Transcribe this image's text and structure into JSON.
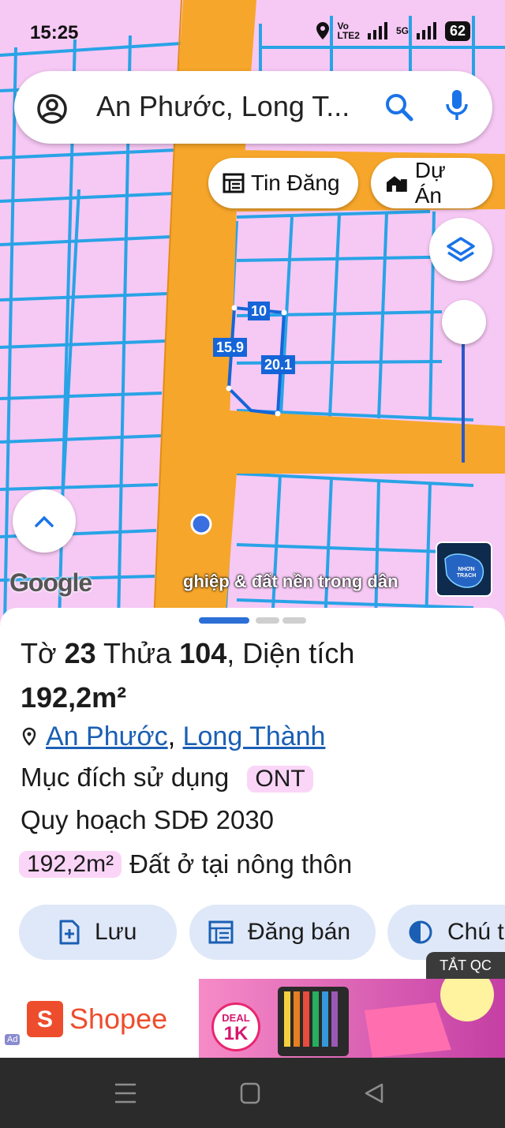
{
  "status_bar": {
    "time": "15:25",
    "net1": "Vo\nLTE2",
    "net2": "5G",
    "battery": "62"
  },
  "search": {
    "text": "An Phước, Long T..."
  },
  "chips": {
    "news": "Tin Đăng",
    "projects": "Dự Án"
  },
  "map": {
    "google_logo": "Google",
    "banner_text": "ghiệp & đất nền trong dân",
    "thumb_text": "NHƠN TRẠCH",
    "dims": {
      "top": "10",
      "left": "15.9",
      "right": "20.1"
    }
  },
  "parcel": {
    "title_prefix": "Tờ",
    "sheet_no": "23",
    "plot_label": "Thửa",
    "plot_no": "104",
    "area_label": ", Diện tích",
    "area": "192,2m²",
    "ward": "An Phước",
    "separator": ",",
    "district": "Long Thành",
    "usage_label": "Mục đích sử dụng",
    "usage_code": "ONT",
    "plan_label": "Quy hoạch SDĐ 2030",
    "zone_area": "192,2m²",
    "zone_desc": "Đất ở tại nông thôn"
  },
  "actions": {
    "save": "Lưu",
    "post": "Đăng bán",
    "note": "Chú t"
  },
  "ad": {
    "close_label": "TẮT QC",
    "brand": "Shopee",
    "deal_top": "DEAL",
    "deal_value": "1K",
    "ad_badge": "Ad"
  },
  "colors": {
    "map_land": "#f6c8f4",
    "road": "#f6a62a",
    "parcel_line": "#1e8fe0",
    "selected": "#1565d8",
    "accent": "#1a5fb4"
  }
}
